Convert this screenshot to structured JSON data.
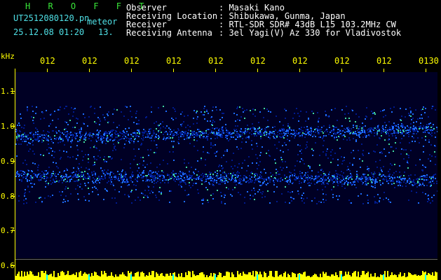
{
  "header": {
    "logo": "H R O F F T",
    "filename": "UT2512080120.pn",
    "meteor_label": "meteor",
    "datetime": "25.12.08 01:20",
    "count": "13.",
    "fields": [
      {
        "key": "Observer",
        "value": ": Masaki Kano"
      },
      {
        "key": "Receiving Location",
        "value": ": Shibukawa, Gunma, Japan"
      },
      {
        "key": "Receiver",
        "value": ": RTL-SDR SDR# 43dB L15 103.2MHz CW"
      },
      {
        "key": "Receiving Antenna",
        "value": ": 3el Yagi(V) Az 330 for Vladivostok"
      }
    ]
  },
  "axis": {
    "y_unit": "kHz",
    "y_labels": [
      "1.1",
      "1.0",
      "0.9",
      "0.8",
      "0.7",
      "0.6"
    ],
    "x_labels": [
      "012",
      "012",
      "012",
      "012",
      "012",
      "012",
      "012",
      "012",
      "012",
      "0130"
    ]
  },
  "colors": {
    "text_yellow": "#ffff00",
    "text_cyan": "#4fe0e6",
    "logo_green": "#39e739",
    "background": "#000000",
    "spectrum_low": "#001a8c",
    "spectrum_mid": "#1e6cff",
    "spectrum_high": "#3fd9a0"
  }
}
